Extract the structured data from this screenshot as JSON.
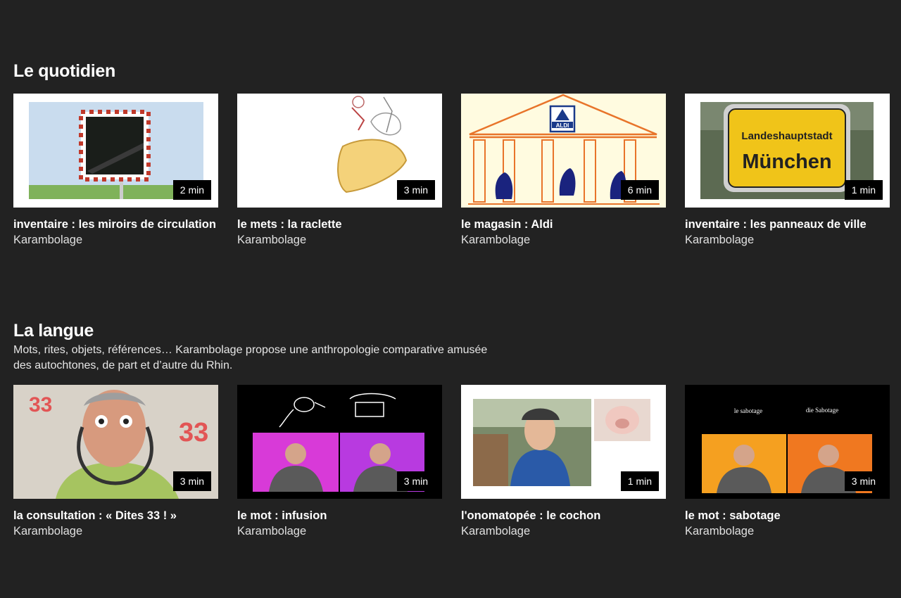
{
  "sections": [
    {
      "title": "Le quotidien",
      "description": "",
      "cards": [
        {
          "title": "inventaire : les miroirs de circulation",
          "subtitle": "Karambolage",
          "duration": "2 min"
        },
        {
          "title": "le mets : la raclette",
          "subtitle": "Karambolage",
          "duration": "3 min"
        },
        {
          "title": "le magasin : Aldi",
          "subtitle": "Karambolage",
          "duration": "6 min",
          "sign_text": "ALDI"
        },
        {
          "title": "inventaire : les panneaux de ville",
          "subtitle": "Karambolage",
          "duration": "1 min",
          "sign_line1": "Landeshauptstadt",
          "sign_line2": "München"
        }
      ]
    },
    {
      "title": "La langue",
      "description": "Mots, rites, objets, références… Karambolage propose une anthropologie comparative amusée des autochtones, de part et d’autre du Rhin.",
      "cards": [
        {
          "title": "la consultation : « Dites 33 ! »",
          "subtitle": "Karambolage",
          "duration": "3 min",
          "wall_text": "33"
        },
        {
          "title": "le mot : infusion",
          "subtitle": "Karambolage",
          "duration": "3 min"
        },
        {
          "title": "l'onomatopée : le cochon",
          "subtitle": "Karambolage",
          "duration": "1 min"
        },
        {
          "title": "le mot : sabotage",
          "subtitle": "Karambolage",
          "duration": "3 min",
          "label_fr": "le sabotage",
          "label_de": "die Sabotage"
        }
      ]
    }
  ]
}
